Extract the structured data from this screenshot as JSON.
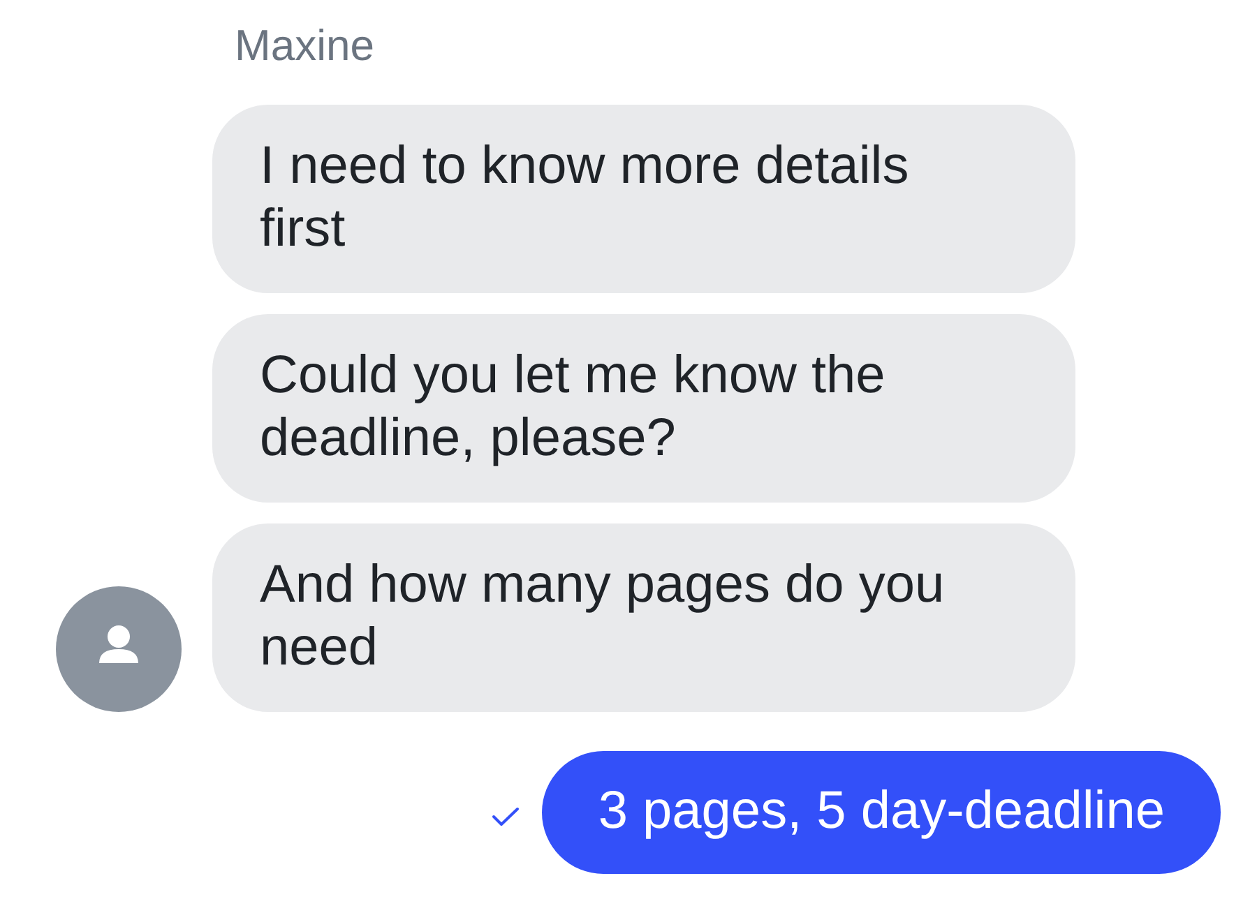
{
  "conversation": {
    "sender_name": "Maxine",
    "incoming": [
      {
        "text": "I need to know more details first"
      },
      {
        "text": "Could you let me know the deadline, please?"
      },
      {
        "text": "And how many pages do you need"
      }
    ],
    "outgoing": [
      {
        "text": "3 pages, 5 day-deadline",
        "delivered": true
      }
    ]
  }
}
